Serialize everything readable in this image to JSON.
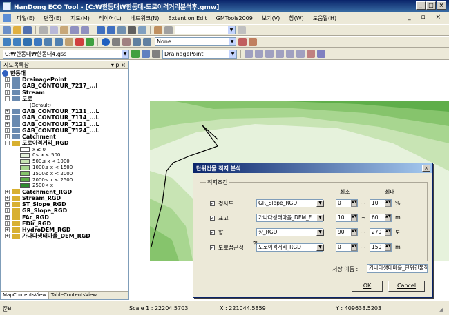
{
  "window": {
    "title": "HanDong ECO Tool - [C:₩한동대₩한동대-도로이격거리분석후.gmw]"
  },
  "menu": [
    "파일(E)",
    "편집(E)",
    "지도(M)",
    "레이어(L)",
    "네트워크(N)",
    "Extention Edit",
    "GMTools2009",
    "보기(V)",
    "창(W)",
    "도움말(H)"
  ],
  "toolbar3": {
    "path": "C:₩한동대₩한동대4.gss",
    "layer_combo": "DrainagePoint",
    "none_combo": "None"
  },
  "left_panel": {
    "title": "지도목록창",
    "layers": [
      {
        "name": "한동대",
        "exp": ""
      },
      {
        "name": "DrainagePoint",
        "exp": "+"
      },
      {
        "name": "GAB_CONTOUR_7217_...l",
        "exp": "+"
      },
      {
        "name": "Stream",
        "exp": "+"
      },
      {
        "name": "도로",
        "exp": "−"
      },
      {
        "name": "(Default)",
        "exp": ""
      },
      {
        "name": "GAB_CONTOUR_7111_...L",
        "exp": "+"
      },
      {
        "name": "GAB_CONTOUR_7114_...L",
        "exp": "+"
      },
      {
        "name": "GAB_CONTOUR_7121_...L",
        "exp": "+"
      },
      {
        "name": "GAB_CONTOUR_7124_...L",
        "exp": "+"
      },
      {
        "name": "Catchment",
        "exp": "+"
      },
      {
        "name": "도로이격거리_RGD",
        "exp": "−"
      }
    ],
    "legend": [
      {
        "label": "x ≤ 0",
        "color": "#ffffff"
      },
      {
        "label": "0< x < 500",
        "color": "#e6f2dc"
      },
      {
        "label": "500≤ x < 1000",
        "color": "#c8e4b4"
      },
      {
        "label": "1000≤ x < 1500",
        "color": "#a8d690"
      },
      {
        "label": "1500≤ x < 2000",
        "color": "#86c46c"
      },
      {
        "label": "2000≤ x < 2500",
        "color": "#5fae4a"
      },
      {
        "label": "2500< x",
        "color": "#2e8b2e"
      }
    ],
    "layers2": [
      {
        "name": "Catchment_RGD",
        "exp": "+"
      },
      {
        "name": "Stream_RGD",
        "exp": "+"
      },
      {
        "name": "ST_Slope_RGD",
        "exp": "+"
      },
      {
        "name": "GR_Slope_RGD",
        "exp": "+"
      },
      {
        "name": "FAc_RGD",
        "exp": "+"
      },
      {
        "name": "FDir_RGD",
        "exp": "+"
      },
      {
        "name": "HydroDEM_RGD",
        "exp": "+"
      },
      {
        "name": "가나다생태마을_DEM_RGD",
        "exp": "+"
      }
    ],
    "tabs": [
      "MapContentsView",
      "TableContentsView"
    ]
  },
  "status": {
    "left": "준비",
    "scale": "Scale 1 : 22204.5703",
    "x": "X : 221044.5859",
    "y": "Y : 409638.5203"
  },
  "dialog": {
    "title": "단위건물 적지 분석",
    "group": "적지조건",
    "col_min": "최소",
    "col_max": "최대",
    "rows": [
      {
        "label": "경사도",
        "layer": "GR_Slope_RGD",
        "min": "0",
        "max": "10",
        "unit": "%"
      },
      {
        "label": "표고",
        "layer": "가나다생태마을_DEM_F",
        "min": "10",
        "max": "60",
        "unit": "m"
      },
      {
        "label": "향",
        "layer": "향_RGD",
        "min": "90",
        "max": "270",
        "unit": "도"
      },
      {
        "label": "도로접근성",
        "layer": "도로이격거리_RGD",
        "min": "0",
        "max": "150",
        "unit": "m"
      }
    ],
    "hyang_note": "향",
    "save_label": "저장 이름 :",
    "save_value": "가나다생태마을_단위건물적지분석",
    "ok": "OK",
    "cancel": "Cancel"
  },
  "colors": {
    "title": "#0a246a",
    "panel": "#ece9d8"
  }
}
